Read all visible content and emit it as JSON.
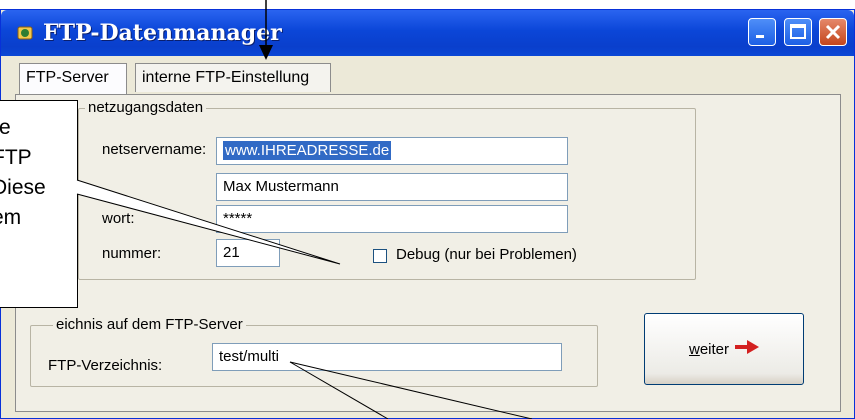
{
  "window": {
    "title": "FTP-Datenmanager",
    "accent": "#0b46d8",
    "icons": [
      "app-icon",
      "minimize-icon",
      "maximize-icon",
      "close-icon"
    ]
  },
  "tabs": [
    {
      "label": "FTP-Server",
      "active": true
    },
    {
      "label": "interne FTP-Einstellung",
      "active": false
    }
  ],
  "access_group": {
    "legend": "netzugangsdaten",
    "server_label": "netservername:",
    "server_value": "www.IHREADRESSE.de",
    "user_value": "Max Mustermann",
    "password_label": "wort:",
    "password_value": "*****",
    "port_label": "nummer:",
    "port_value": "21",
    "debug_label": "Debug (nur bei Problemen)",
    "debug_checked": false
  },
  "directory_group": {
    "legend": "eichnis auf dem FTP-Server",
    "dir_label": "FTP-Verzeichnis:",
    "dir_value": "test/multi"
  },
  "next_button": {
    "label_underlined": "w",
    "label_rest": "eiter",
    "icon": "arrow-right-icon"
  },
  "callout": {
    "lines": [
      "re",
      "FTP",
      "Diese",
      "em"
    ]
  }
}
